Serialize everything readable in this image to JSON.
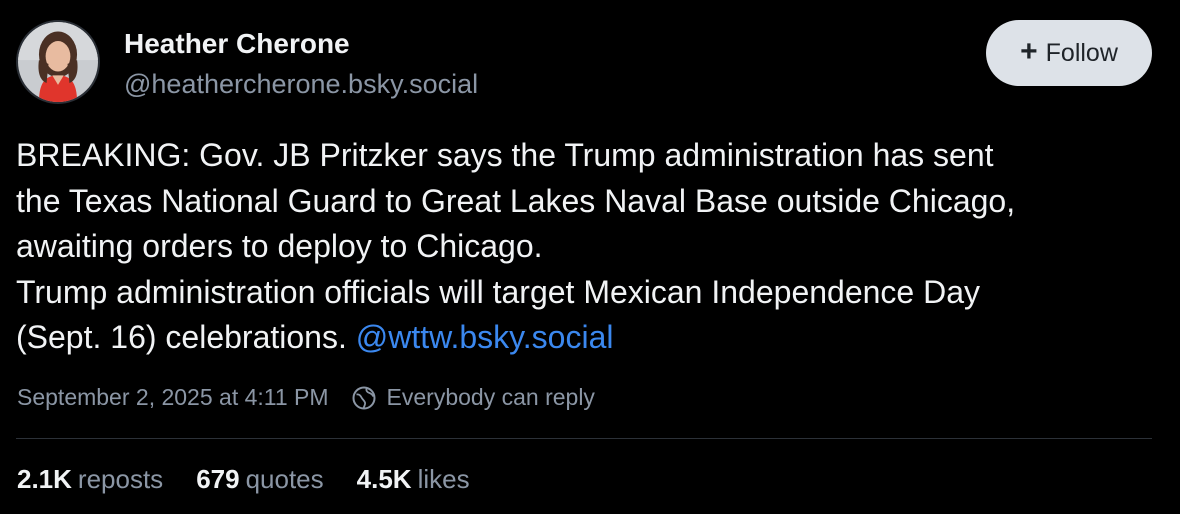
{
  "author": {
    "name": "Heather Cherone",
    "handle": "@heathercherone.bsky.social"
  },
  "follow_button": {
    "icon": "+",
    "label": "Follow"
  },
  "post": {
    "lines": [
      "BREAKING: Gov. JB Pritzker says the Trump administration has sent",
      "the Texas National Guard to Great Lakes Naval Base outside Chicago,",
      "awaiting orders to deploy to Chicago.",
      "Trump administration officials will target Mexican Independence Day"
    ],
    "last_line_text": "(Sept. 16) celebrations.",
    "mention": "@wttw.bsky.social"
  },
  "meta": {
    "timestamp": "September 2, 2025 at 4:11 PM",
    "reply_setting": "Everybody can reply"
  },
  "stats": {
    "reposts": {
      "count": "2.1K",
      "label": "reposts"
    },
    "quotes": {
      "count": "679",
      "label": "quotes"
    },
    "likes": {
      "count": "4.5K",
      "label": "likes"
    }
  },
  "colors": {
    "background": "#000000",
    "text": "#f1f3f5",
    "muted": "#8b96a5",
    "link": "#3b88ef",
    "follow_bg": "#dde2e8"
  }
}
